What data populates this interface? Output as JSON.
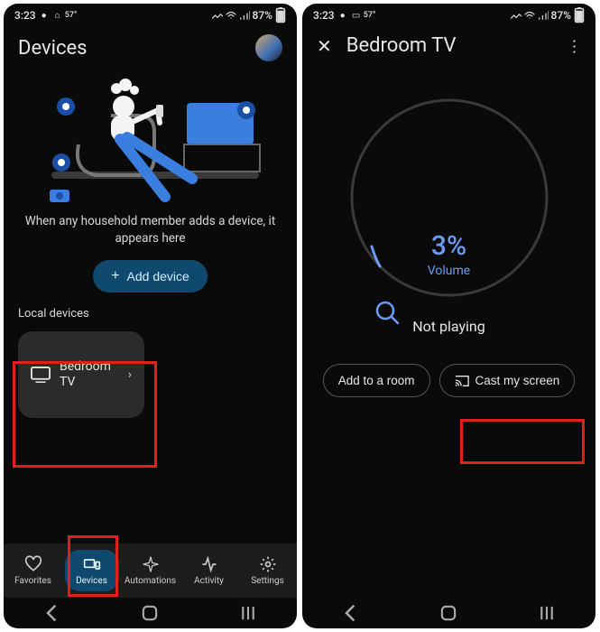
{
  "status": {
    "time": "3:23",
    "battery": "87%"
  },
  "left_screen": {
    "title": "Devices",
    "empty_message": "When any household member adds a device, it appears here",
    "add_device_label": "Add device",
    "section_label": "Local devices",
    "device_name": "Bedroom TV",
    "tabs": {
      "favorites": "Favorites",
      "devices": "Devices",
      "automations": "Automations",
      "activity": "Activity",
      "settings": "Settings"
    }
  },
  "right_screen": {
    "title": "Bedroom TV",
    "volume_pct": "3%",
    "volume_label": "Volume",
    "playing_state": "Not playing",
    "add_room_label": "Add to a room",
    "cast_label": "Cast my screen"
  }
}
